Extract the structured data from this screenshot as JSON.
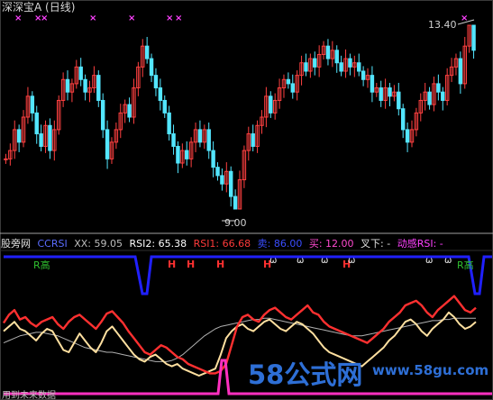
{
  "window": {
    "title": "深深宝A (日线)"
  },
  "price_panel": {
    "high_label": "13.40",
    "low_label": "9.00"
  },
  "indicator_bar": {
    "items": [
      {
        "text": "股旁网",
        "color": "#e0e0e0"
      },
      {
        "text": "CCRSI",
        "color": "#5a6cff"
      },
      {
        "text": "XX: 59.05",
        "color": "#bdbdbd"
      },
      {
        "text": "RSI2: 65.38",
        "color": "#ffffff"
      },
      {
        "text": "RSI1: 66.68",
        "color": "#ff3a3a"
      },
      {
        "text": "卖: 86.00",
        "color": "#3a4dff"
      },
      {
        "text": "买: 12.00",
        "color": "#ff4ad0"
      },
      {
        "text": "叉下: -",
        "color": "#e0e0e0"
      },
      {
        "text": "动感RSI: -",
        "color": "#ff40ff"
      }
    ]
  },
  "markers": {
    "h": "H",
    "o": "ω",
    "r": "R高",
    "x": "×"
  },
  "watermark": {
    "text": "58公式网",
    "url": "www.58gu.com"
  },
  "footer": {
    "text": "用到未来数据"
  },
  "colors": {
    "up": "#ff4040",
    "down": "#53e6ff",
    "rsi1": "#ff3030",
    "rsi2": "#ffe0a0",
    "xx": "#b0b0b0",
    "sell": "#2020ff",
    "buy": "#ff30c0"
  },
  "chart_data": [
    {
      "type": "candlestick",
      "title": "深深宝A (日线)",
      "annotations": [
        {
          "label": "13.40",
          "kind": "high"
        },
        {
          "label": "9.00",
          "kind": "low"
        }
      ],
      "closes": [
        10.2,
        10.4,
        10.9,
        10.6,
        11.2,
        11.7,
        11.3,
        10.8,
        10.5,
        11.0,
        10.4,
        10.9,
        11.6,
        12.1,
        11.8,
        12.0,
        12.4,
        12.1,
        11.8,
        11.9,
        12.2,
        11.6,
        10.9,
        10.2,
        10.6,
        10.9,
        11.3,
        11.5,
        11.2,
        11.9,
        12.4,
        12.9,
        12.6,
        12.2,
        11.9,
        11.6,
        11.3,
        10.8,
        10.5,
        10.1,
        10.4,
        10.2,
        10.6,
        10.9,
        10.6,
        10.9,
        10.4,
        10.0,
        9.8,
        9.6,
        9.9,
        9.3,
        9.0,
        9.7,
        10.4,
        10.8,
        10.5,
        11.0,
        11.2,
        11.7,
        11.3,
        11.6,
        11.9,
        12.1,
        12.0,
        11.8,
        12.2,
        12.5,
        12.3,
        12.6,
        12.4,
        12.7,
        12.9,
        12.6,
        12.8,
        12.5,
        12.3,
        12.6,
        12.4,
        12.5,
        12.3,
        12.1,
        12.2,
        11.8,
        11.9,
        11.6,
        11.9,
        11.7,
        11.8,
        11.4,
        10.9,
        10.6,
        10.9,
        11.3,
        11.6,
        11.8,
        11.5,
        12.0,
        11.8,
        11.6,
        12.2,
        12.4,
        12.6,
        12.0,
        12.9,
        13.4,
        12.8
      ]
    },
    {
      "type": "line",
      "series": [
        {
          "name": "RSI1",
          "values": [
            55,
            62,
            66,
            58,
            60,
            55,
            52,
            56,
            58,
            60,
            54,
            50,
            56,
            60,
            62,
            58,
            54,
            50,
            56,
            63,
            65,
            60,
            55,
            48,
            42,
            36,
            30,
            28,
            32,
            36,
            34,
            30,
            26,
            24,
            20,
            18,
            16,
            14,
            12,
            12,
            14,
            20,
            36,
            52,
            60,
            62,
            58,
            56,
            62,
            66,
            68,
            64,
            60,
            58,
            62,
            66,
            70,
            64,
            62,
            56,
            52,
            50,
            48,
            46,
            44,
            42,
            40,
            38,
            42,
            46,
            50,
            56,
            60,
            64,
            70,
            72,
            74,
            70,
            64,
            60,
            66,
            70,
            74,
            78,
            72,
            66,
            64,
            68
          ]
        },
        {
          "name": "RSI2",
          "values": [
            48,
            52,
            56,
            50,
            48,
            44,
            40,
            46,
            50,
            48,
            40,
            32,
            30,
            38,
            46,
            40,
            34,
            30,
            38,
            48,
            52,
            46,
            40,
            34,
            28,
            24,
            22,
            26,
            28,
            24,
            20,
            18,
            20,
            16,
            14,
            12,
            10,
            12,
            14,
            16,
            28,
            42,
            48,
            52,
            54,
            50,
            48,
            52,
            56,
            58,
            54,
            50,
            48,
            52,
            56,
            54,
            50,
            46,
            40,
            34,
            30,
            28,
            26,
            24,
            22,
            20,
            18,
            22,
            26,
            30,
            34,
            40,
            44,
            50,
            56,
            58,
            54,
            48,
            44,
            50,
            54,
            58,
            64,
            60,
            54,
            50,
            52,
            56
          ]
        },
        {
          "name": "XX",
          "values": [
            38,
            40,
            42,
            44,
            45,
            46,
            47,
            47,
            46,
            45,
            44,
            42,
            40,
            38,
            36,
            34,
            33,
            32,
            31,
            30,
            30,
            29,
            28,
            27,
            26,
            25,
            24,
            23,
            22,
            22,
            22,
            23,
            25,
            28,
            32,
            36,
            40,
            44,
            47,
            50,
            52,
            53,
            54,
            55,
            56,
            57,
            58,
            58,
            59,
            59,
            58,
            57,
            56,
            55,
            54,
            53,
            52,
            51,
            50,
            49,
            48,
            47,
            46,
            45,
            44,
            44,
            44,
            45,
            46,
            47,
            48,
            49,
            50,
            51,
            52,
            53,
            54,
            55,
            56,
            57,
            57,
            58,
            58,
            59,
            59,
            59,
            59,
            59
          ]
        }
      ]
    }
  ]
}
